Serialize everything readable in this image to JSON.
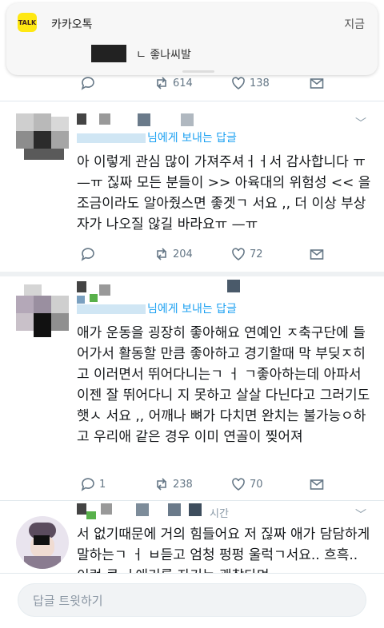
{
  "notification": {
    "app_icon_text": "TALK",
    "app_name": "카카오톡",
    "time": "지금",
    "message": "ㄴ 좋나씨발"
  },
  "tweet0": {
    "retweets": "614",
    "likes": "138"
  },
  "tweet1": {
    "reply_to": "님에게 보내는 답글",
    "text": "아 이렇게 관심 많이 가져주셔ㅓㅓ서 감사합니다 ㅠ—ㅠ 짆짜 모든 분들이 >> 아육대의 위험성 << 을 조금이라도 알아줬스면 좋겟ㄱ 서요 ,, 더 이상 부상자가 나오질 않길 바라요ㅠ —ㅠ",
    "retweets": "204",
    "likes": "72"
  },
  "tweet2": {
    "reply_to": "님에게 보내는 답글",
    "text": "애가 운동을 굉장히 좋아해요 연예인 ㅈ축구단에 들어가서 활동할 만큼 좋아하고 경기할때 막 부딪ㅈ히고 이러면서 뛰어다니는ㄱ ㅓ ㄱ좋아하는데 아파서 이젠 잘 뛰어다니 지 못하고 살살 다닌다고 그러기도햇ㅅ 서요 ,, 어깨나 뼈가 다치면 완치는 불가능ㅇ하고 우리애 같은 경우 이미 연골이 찢어져",
    "replies": "1",
    "retweets": "238",
    "likes": "70"
  },
  "tweet3": {
    "time_suffix": "시간",
    "text": "서 없기때문에 거의 힘들어요 저 짆짜 애가 담담하게 말하는ㄱ ㅓ ㅂ듣고 엄청 펑펑 울럭ㄱ서요.. 흐흑.. 이런 큰 ㅓ애기를 자기는 괜찮다며"
  },
  "reply_bar": {
    "placeholder": "답글 트윗하기"
  },
  "colors": {
    "accent": "#1da1f2",
    "icon_gray": "#657786",
    "text": "#14171a",
    "kakao_yellow": "#ffe812"
  }
}
